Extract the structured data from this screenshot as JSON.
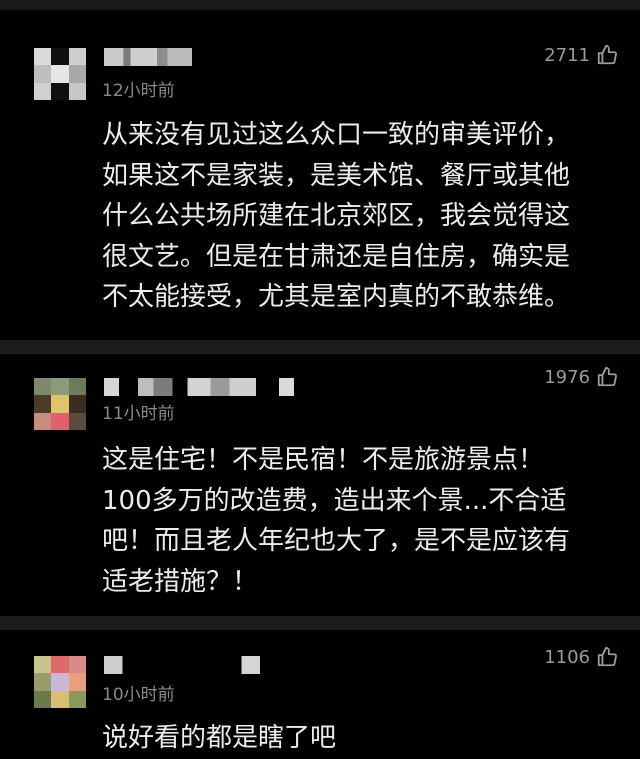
{
  "comments": [
    {
      "time": "12小时前",
      "likes": "2711",
      "lines": [
        "从来没有见过这么众口一致的审美评价，",
        "如果这不是家装，是美术馆、餐厅或其他",
        "什么公共场所建在北京郊区，我会觉得这",
        "很文艺。但是在甘肃还是自住房，确实是",
        "不太能接受，尤其是室内真的不敢恭维。"
      ]
    },
    {
      "time": "11小时前",
      "likes": "1976",
      "lines": [
        "这是住宅！不是民宿！不是旅游景点！",
        "100多万的改造费，造出来个景...不合适",
        "吧！而且老人年纪也大了，是不是应该有",
        "适老措施？！"
      ]
    },
    {
      "time": "10小时前",
      "likes": "1106",
      "lines": [
        "说好看的都是瞎了吧"
      ]
    }
  ],
  "icons": {
    "like": "thumbs-up-icon"
  },
  "colors": {
    "background": "#000000",
    "text": "#ececec",
    "meta": "#8a8a8a"
  }
}
